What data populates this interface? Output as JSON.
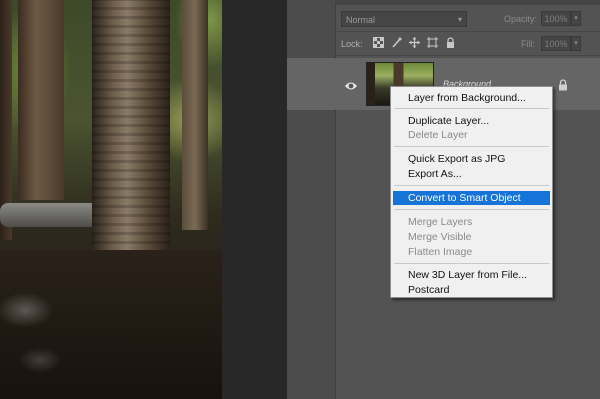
{
  "panel": {
    "blend_mode": "Normal",
    "opacity_label": "Opacity:",
    "opacity_value": "100%",
    "lock_label": "Lock:",
    "fill_label": "Fill:",
    "fill_value": "100%"
  },
  "layer": {
    "name": "Background",
    "visible": true,
    "locked": true
  },
  "context_menu": {
    "items": [
      {
        "label": "Layer from Background...",
        "enabled": true
      },
      {
        "label": "Duplicate Layer...",
        "enabled": true
      },
      {
        "label": "Delete Layer",
        "enabled": false
      },
      {
        "label": "Quick Export as JPG",
        "enabled": true
      },
      {
        "label": "Export As...",
        "enabled": true
      },
      {
        "label": "Convert to Smart Object",
        "enabled": true,
        "highlighted": true
      },
      {
        "label": "Merge Layers",
        "enabled": false
      },
      {
        "label": "Merge Visible",
        "enabled": false
      },
      {
        "label": "Flatten Image",
        "enabled": false
      },
      {
        "label": "New 3D Layer from File...",
        "enabled": true
      },
      {
        "label": "Postcard",
        "enabled": true
      }
    ]
  },
  "colors": {
    "highlight": "#1673d8",
    "menu_background": "#f0f0f0",
    "panel_background": "#535353"
  }
}
